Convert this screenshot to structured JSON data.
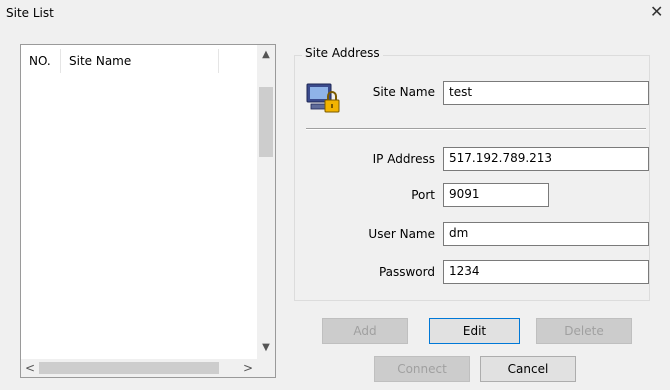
{
  "window": {
    "title": "Site List",
    "close_glyph": "✕"
  },
  "list": {
    "columns": [
      "NO.",
      "Site Name"
    ],
    "rows": [],
    "scroll_up": "▲",
    "scroll_down": "▼",
    "scroll_left": "<",
    "scroll_right": ">"
  },
  "group": {
    "title": "Site Address",
    "icon": "computer-lock-icon",
    "fields": {
      "site_name": {
        "label": "Site Name",
        "value": "test"
      },
      "ip_address": {
        "label": "IP Address",
        "value": "517.192.789.213"
      },
      "port": {
        "label": "Port",
        "value": "9091"
      },
      "user_name": {
        "label": "User Name",
        "value": "dm"
      },
      "password": {
        "label": "Password",
        "value": "1234"
      }
    }
  },
  "buttons": {
    "add": "Add",
    "edit": "Edit",
    "delete": "Delete",
    "connect": "Connect",
    "cancel": "Cancel"
  }
}
